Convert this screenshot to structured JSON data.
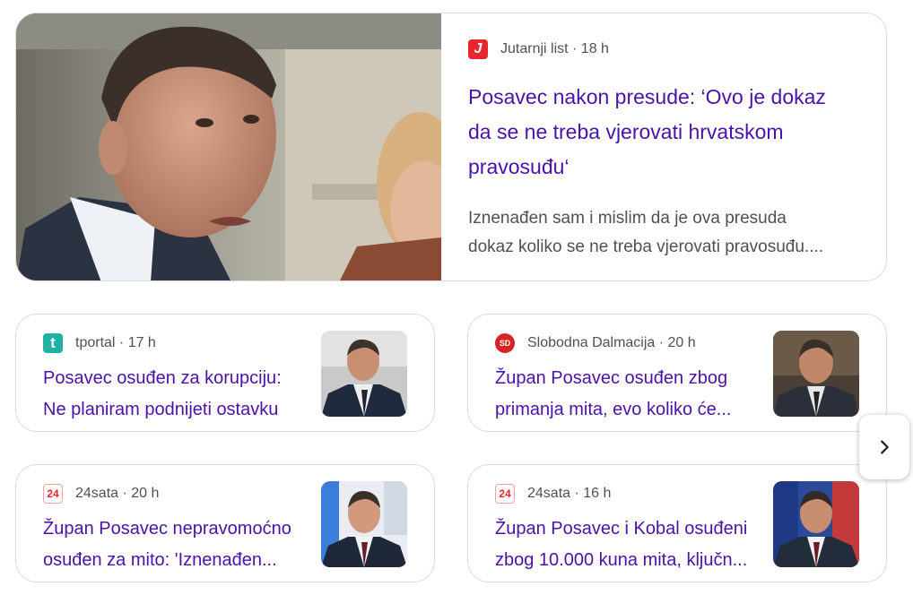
{
  "featured": {
    "source": "Jutarnji list",
    "age": "18 h",
    "favicon_letter": "J",
    "title_line1": "Posavec nakon presude: ‘Ovo je dokaz",
    "title_line2": "da se ne treba vjerovati hrvatskom",
    "title_line3": "pravosuđu‘",
    "snippet_line1": "Iznenađen sam i mislim da je ova presuda",
    "snippet_line2": "dokaz koliko se ne treba vjerovati pravosuđu...."
  },
  "stories": [
    {
      "source": "tportal",
      "age": "17 h",
      "favicon_letter": "t",
      "title_line1": "Posavec osuđen za korupciju:",
      "title_line2": "Ne planiram podnijeti ostavku"
    },
    {
      "source": "Slobodna Dalmacija",
      "age": "20 h",
      "favicon_letter": "SD",
      "title_line1": "Župan Posavec osuđen zbog",
      "title_line2": "primanja mita, evo koliko će..."
    },
    {
      "source": "24sata",
      "age": "20 h",
      "favicon_letter": "24",
      "title_line1": "Župan Posavec nepravomoćno",
      "title_line2": "osuđen za mito: 'Iznenađen..."
    },
    {
      "source": "24sata",
      "age": "16 h",
      "favicon_letter": "24",
      "title_line1": "Župan Posavec i Kobal osuđeni",
      "title_line2": "zbog 10.000 kuna mita, ključn..."
    }
  ],
  "separator": " · ",
  "next_icon": "chevron-right-icon"
}
